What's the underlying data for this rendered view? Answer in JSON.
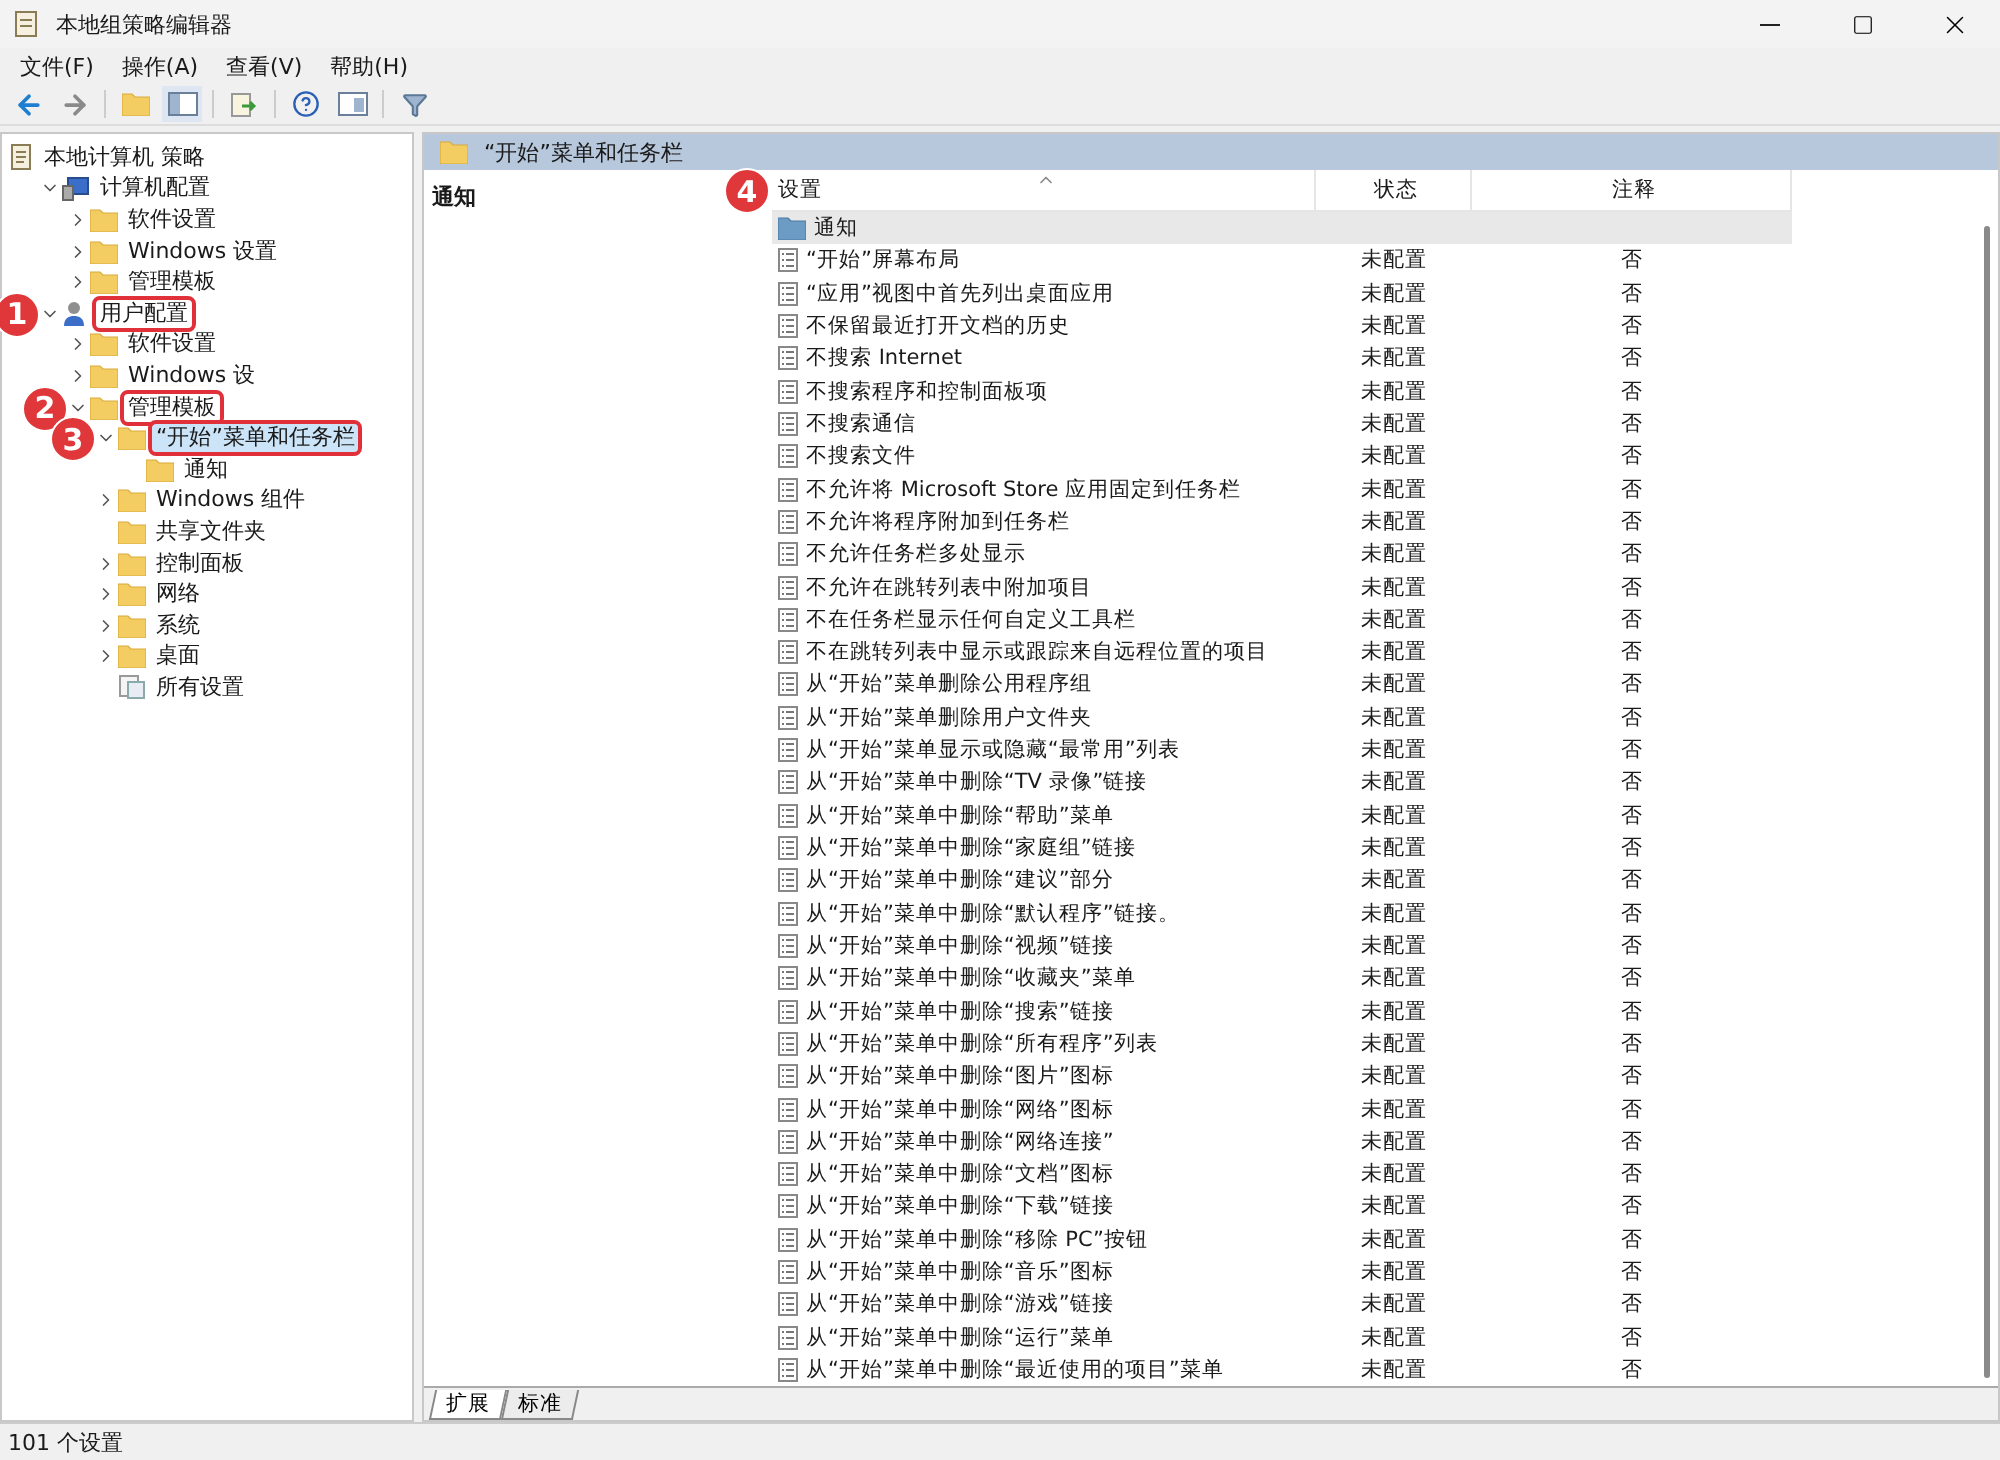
{
  "window": {
    "title": "本地组策略编辑器"
  },
  "menu": [
    "文件(F)",
    "操作(A)",
    "查看(V)",
    "帮助(H)"
  ],
  "tree": [
    {
      "label": "本地计算机 策略",
      "kind": "policy",
      "children": [
        {
          "label": "计算机配置",
          "kind": "computer",
          "expanded": true,
          "children": [
            {
              "label": "软件设置",
              "kind": "folder",
              "expanded": false
            },
            {
              "label": "Windows 设置",
              "kind": "folder",
              "expanded": false
            },
            {
              "label": "管理模板",
              "kind": "folder",
              "expanded": false
            }
          ]
        },
        {
          "label": "用户配置",
          "kind": "user",
          "expanded": true,
          "callout": "1",
          "children": [
            {
              "label": "软件设置",
              "kind": "folder",
              "expanded": false
            },
            {
              "label": "Windows 设",
              "kind": "folder",
              "expanded": false
            },
            {
              "label": "管理模板",
              "kind": "folder",
              "expanded": true,
              "callout": "2",
              "children": [
                {
                  "label": "“开始”菜单和任务栏",
                  "kind": "folder",
                  "expanded": true,
                  "selected": true,
                  "callout": "3",
                  "children": [
                    {
                      "label": "通知",
                      "kind": "folder"
                    }
                  ]
                },
                {
                  "label": "Windows 组件",
                  "kind": "folder",
                  "expanded": false
                },
                {
                  "label": "共享文件夹",
                  "kind": "folder"
                },
                {
                  "label": "控制面板",
                  "kind": "folder",
                  "expanded": false
                },
                {
                  "label": "网络",
                  "kind": "folder",
                  "expanded": false
                },
                {
                  "label": "系统",
                  "kind": "folder",
                  "expanded": false
                },
                {
                  "label": "桌面",
                  "kind": "folder",
                  "expanded": false
                },
                {
                  "label": "所有设置",
                  "kind": "settings"
                }
              ]
            }
          ]
        }
      ]
    }
  ],
  "pane": {
    "title": "“开始”菜单和任务栏",
    "description": "通知",
    "columns": [
      {
        "label": "设置",
        "callout": "4"
      },
      {
        "label": "状态"
      },
      {
        "label": "注释"
      }
    ],
    "rows": [
      {
        "kind": "folder",
        "name": "通知",
        "selected": true
      },
      {
        "kind": "policy",
        "name": "“开始”屏幕布局",
        "state": "未配置",
        "comment": "否",
        "selected": false
      },
      {
        "kind": "policy",
        "name": "“应用”视图中首先列出桌面应用",
        "state": "未配置",
        "comment": "否",
        "selected": false
      },
      {
        "kind": "policy",
        "name": "不保留最近打开文档的历史",
        "state": "未配置",
        "comment": "否",
        "selected": false
      },
      {
        "kind": "policy",
        "name": "不搜索 Internet",
        "state": "未配置",
        "comment": "否",
        "selected": false
      },
      {
        "kind": "policy",
        "name": "不搜索程序和控制面板项",
        "state": "未配置",
        "comment": "否",
        "selected": false
      },
      {
        "kind": "policy",
        "name": "不搜索通信",
        "state": "未配置",
        "comment": "否",
        "selected": false
      },
      {
        "kind": "policy",
        "name": "不搜索文件",
        "state": "未配置",
        "comment": "否",
        "selected": false
      },
      {
        "kind": "policy",
        "name": "不允许将 Microsoft Store 应用固定到任务栏",
        "state": "未配置",
        "comment": "否",
        "selected": false
      },
      {
        "kind": "policy",
        "name": "不允许将程序附加到任务栏",
        "state": "未配置",
        "comment": "否",
        "selected": false
      },
      {
        "kind": "policy",
        "name": "不允许任务栏多处显示",
        "state": "未配置",
        "comment": "否",
        "selected": false
      },
      {
        "kind": "policy",
        "name": "不允许在跳转列表中附加项目",
        "state": "未配置",
        "comment": "否",
        "selected": false
      },
      {
        "kind": "policy",
        "name": "不在任务栏显示任何自定义工具栏",
        "state": "未配置",
        "comment": "否",
        "selected": false
      },
      {
        "kind": "policy",
        "name": "不在跳转列表中显示或跟踪来自远程位置的项目",
        "state": "未配置",
        "comment": "否",
        "selected": false
      },
      {
        "kind": "policy",
        "name": "从“开始”菜单删除公用程序组",
        "state": "未配置",
        "comment": "否",
        "selected": false
      },
      {
        "kind": "policy",
        "name": "从“开始”菜单删除用户文件夹",
        "state": "未配置",
        "comment": "否",
        "selected": false
      },
      {
        "kind": "policy",
        "name": "从“开始”菜单显示或隐藏“最常用”列表",
        "state": "未配置",
        "comment": "否",
        "selected": false
      },
      {
        "kind": "policy",
        "name": "从“开始”菜单中删除“TV 录像”链接",
        "state": "未配置",
        "comment": "否",
        "selected": false
      },
      {
        "kind": "policy",
        "name": "从“开始”菜单中删除“帮助”菜单",
        "state": "未配置",
        "comment": "否",
        "selected": false
      },
      {
        "kind": "policy",
        "name": "从“开始”菜单中删除“家庭组”链接",
        "state": "未配置",
        "comment": "否",
        "selected": false
      },
      {
        "kind": "policy",
        "name": "从“开始”菜单中删除“建议”部分",
        "state": "未配置",
        "comment": "否",
        "selected": false
      },
      {
        "kind": "policy",
        "name": "从“开始”菜单中删除“默认程序”链接。",
        "state": "未配置",
        "comment": "否",
        "selected": false
      },
      {
        "kind": "policy",
        "name": "从“开始”菜单中删除“视频”链接",
        "state": "未配置",
        "comment": "否",
        "selected": false
      },
      {
        "kind": "policy",
        "name": "从“开始”菜单中删除“收藏夹”菜单",
        "state": "未配置",
        "comment": "否",
        "selected": false
      },
      {
        "kind": "policy",
        "name": "从“开始”菜单中删除“搜索”链接",
        "state": "未配置",
        "comment": "否",
        "selected": false
      },
      {
        "kind": "policy",
        "name": "从“开始”菜单中删除“所有程序”列表",
        "state": "未配置",
        "comment": "否",
        "selected": false
      },
      {
        "kind": "policy",
        "name": "从“开始”菜单中删除“图片”图标",
        "state": "未配置",
        "comment": "否",
        "selected": false
      },
      {
        "kind": "policy",
        "name": "从“开始”菜单中删除“网络”图标",
        "state": "未配置",
        "comment": "否",
        "selected": false
      },
      {
        "kind": "policy",
        "name": "从“开始”菜单中删除“网络连接”",
        "state": "未配置",
        "comment": "否",
        "selected": false
      },
      {
        "kind": "policy",
        "name": "从“开始”菜单中删除“文档”图标",
        "state": "未配置",
        "comment": "否",
        "selected": false
      },
      {
        "kind": "policy",
        "name": "从“开始”菜单中删除“下载”链接",
        "state": "未配置",
        "comment": "否",
        "selected": false
      },
      {
        "kind": "policy",
        "name": "从“开始”菜单中删除“移除 PC”按钮",
        "state": "未配置",
        "comment": "否",
        "selected": false
      },
      {
        "kind": "policy",
        "name": "从“开始”菜单中删除“音乐”图标",
        "state": "未配置",
        "comment": "否",
        "selected": false
      },
      {
        "kind": "policy",
        "name": "从“开始”菜单中删除“游戏”链接",
        "state": "未配置",
        "comment": "否",
        "selected": false
      },
      {
        "kind": "policy",
        "name": "从“开始”菜单中删除“运行”菜单",
        "state": "未配置",
        "comment": "否",
        "selected": false
      },
      {
        "kind": "policy",
        "name": "从“开始”菜单中删除“最近使用的项目”菜单",
        "state": "未配置",
        "comment": "否",
        "selected": false
      }
    ],
    "tabs": [
      {
        "label": "扩展",
        "selected": true
      },
      {
        "label": "标准",
        "selected": false
      }
    ]
  },
  "status_bar": "101 个设置"
}
